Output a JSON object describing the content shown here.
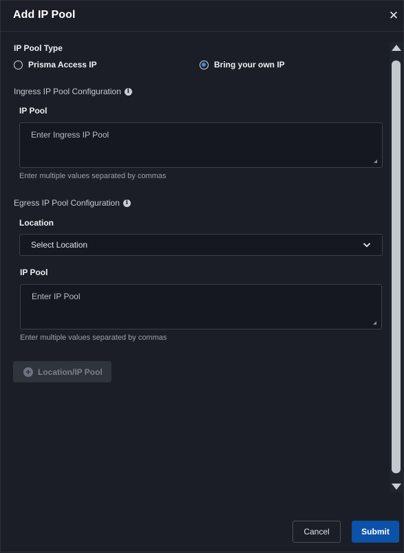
{
  "dialog": {
    "title": "Add IP Pool",
    "close_icon": "close-icon"
  },
  "ip_pool_type": {
    "label": "IP Pool Type",
    "options": [
      {
        "label": "Prisma Access IP",
        "selected": false
      },
      {
        "label": "Bring your own IP",
        "selected": true
      }
    ]
  },
  "ingress": {
    "section_label": "Ingress IP Pool Configuration",
    "info_icon": "info-icon",
    "ip_pool_label": "IP Pool",
    "ip_pool_placeholder": "Enter Ingress IP Pool",
    "helper": "Enter multiple values separated by commas"
  },
  "egress": {
    "section_label": "Egress IP Pool Configuration",
    "info_icon": "info-icon",
    "location_label": "Location",
    "location_placeholder": "Select Location",
    "ip_pool_label": "IP Pool",
    "ip_pool_placeholder": "Enter IP Pool",
    "helper": "Enter multiple values separated by commas",
    "add_button_label": "Location/IP Pool"
  },
  "footer": {
    "cancel_label": "Cancel",
    "submit_label": "Submit"
  },
  "colors": {
    "background": "#1b1e26",
    "accent": "#3d8fe8",
    "submit": "#0c52a8"
  }
}
